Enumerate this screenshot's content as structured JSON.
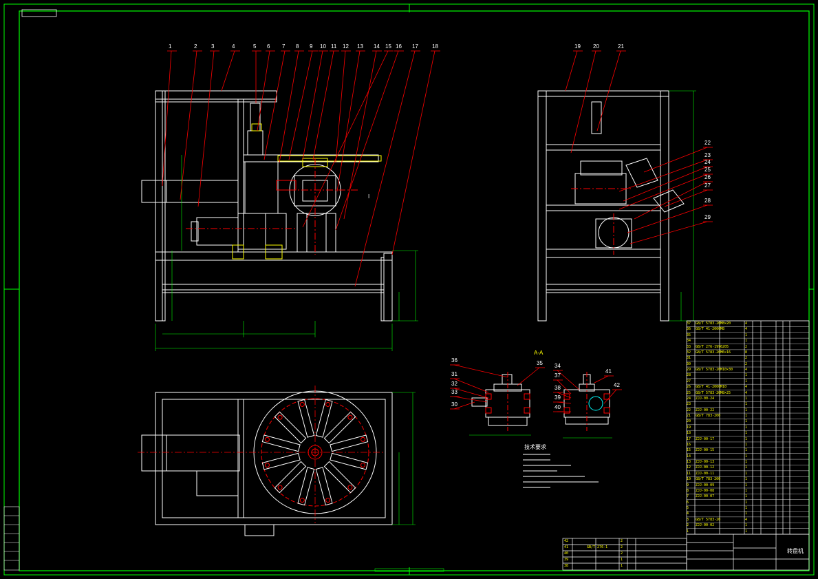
{
  "drawing": {
    "balloons_front": [
      "1",
      "2",
      "3",
      "4",
      "5",
      "6",
      "7",
      "8",
      "9",
      "10",
      "11",
      "12",
      "13",
      "14",
      "15",
      "16",
      "17",
      "18"
    ],
    "balloons_side": [
      "19",
      "20",
      "21"
    ],
    "balloons_side_right": [
      "22",
      "23",
      "24",
      "25",
      "26",
      "27",
      "28",
      "29"
    ],
    "balloons_detail_left": [
      "36",
      "31",
      "32",
      "33",
      "30",
      "35"
    ],
    "balloons_detail_right": [
      "34",
      "37",
      "38",
      "39",
      "40",
      "41",
      "42"
    ],
    "callout_I": "I",
    "detail_title": "A-A",
    "tech_req_title": "技术要求",
    "bom_rows": [
      {
        "no": "37",
        "code": "GB/T 5783-2000",
        "name": "M8×20",
        "qty": "4"
      },
      {
        "no": "36",
        "code": "GB/T 41-2000",
        "name": "M8",
        "qty": "4"
      },
      {
        "no": "35",
        "code": "",
        "name": "",
        "qty": "1"
      },
      {
        "no": "34",
        "code": "",
        "name": "",
        "qty": "1"
      },
      {
        "no": "33",
        "code": "GB/T 276-1994",
        "name": "6205",
        "qty": "2"
      },
      {
        "no": "32",
        "code": "GB/T 5783-2000",
        "name": "M6×16",
        "qty": "8"
      },
      {
        "no": "31",
        "code": "",
        "name": "",
        "qty": "2"
      },
      {
        "no": "30",
        "code": "",
        "name": "",
        "qty": "2"
      },
      {
        "no": "29",
        "code": "GB/T 5783-2000",
        "name": "M10×30",
        "qty": "4"
      },
      {
        "no": "28",
        "code": "",
        "name": "",
        "qty": "1"
      },
      {
        "no": "27",
        "code": "",
        "name": "",
        "qty": "1"
      },
      {
        "no": "26",
        "code": "GB/T 41-2000",
        "name": "M10",
        "qty": "4"
      },
      {
        "no": "25",
        "code": "GB/T 5783-2000",
        "name": "M8×25",
        "qty": "4"
      },
      {
        "no": "24",
        "code": "ZJJ-00-24",
        "name": "",
        "qty": "1"
      },
      {
        "no": "23",
        "code": "",
        "name": "",
        "qty": "1"
      },
      {
        "no": "22",
        "code": "ZJJ-00-22",
        "name": "",
        "qty": "1"
      },
      {
        "no": "21",
        "code": "GB/T 783-2000",
        "name": "",
        "qty": "1"
      },
      {
        "no": "20",
        "code": "",
        "name": "",
        "qty": "1"
      },
      {
        "no": "19",
        "code": "",
        "name": "",
        "qty": "1"
      },
      {
        "no": "18",
        "code": "",
        "name": "",
        "qty": "1"
      },
      {
        "no": "17",
        "code": "ZJJ-00-17",
        "name": "",
        "qty": "1"
      },
      {
        "no": "16",
        "code": "",
        "name": "",
        "qty": "1"
      },
      {
        "no": "15",
        "code": "ZJJ-00-15",
        "name": "",
        "qty": "1"
      },
      {
        "no": "14",
        "code": "",
        "name": "",
        "qty": "1"
      },
      {
        "no": "13",
        "code": "ZJJ-00-13",
        "name": "",
        "qty": "1"
      },
      {
        "no": "12",
        "code": "ZJJ-00-12",
        "name": "",
        "qty": "1"
      },
      {
        "no": "11",
        "code": "ZJJ-00-11",
        "name": "",
        "qty": "1"
      },
      {
        "no": "10",
        "code": "GB/T 783-2000",
        "name": "",
        "qty": "1"
      },
      {
        "no": "9",
        "code": "ZJJ-00-09",
        "name": "",
        "qty": "1"
      },
      {
        "no": "8",
        "code": "ZJJ-00-08",
        "name": "",
        "qty": "1"
      },
      {
        "no": "7",
        "code": "ZJJ-00-07",
        "name": "",
        "qty": "1"
      },
      {
        "no": "6",
        "code": "",
        "name": "",
        "qty": "1"
      },
      {
        "no": "5",
        "code": "",
        "name": "",
        "qty": "1"
      },
      {
        "no": "4",
        "code": "",
        "name": "",
        "qty": "1"
      },
      {
        "no": "3",
        "code": "GB/T 5783-2000",
        "name": "",
        "qty": "4"
      },
      {
        "no": "2",
        "code": "ZJJ-00-02",
        "name": "",
        "qty": "1"
      },
      {
        "no": "1",
        "code": "",
        "name": "",
        "qty": "1"
      }
    ],
    "lower_bom_rows": [
      {
        "no": "42",
        "code": "",
        "qty": "2"
      },
      {
        "no": "41",
        "code": "GB/T 276-1994",
        "qty": "2"
      },
      {
        "no": "40",
        "code": "",
        "qty": "2"
      },
      {
        "no": "39",
        "code": "",
        "qty": "1"
      },
      {
        "no": "38",
        "code": "",
        "qty": "1"
      }
    ],
    "title_block_name": "转盘机"
  },
  "colors": {
    "frame": "#00ff00",
    "outline": "#ffffff",
    "leader": "#ff0000",
    "dimension": "#00ff00",
    "text": "#ffffff",
    "table_text": "#ffff00",
    "bg": "#000000"
  }
}
